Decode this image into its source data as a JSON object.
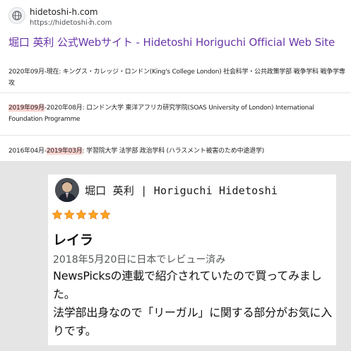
{
  "search_result": {
    "site_name": "hidetoshi-h.com",
    "site_url": "https://hidetoshi-h.com",
    "menu_icon": "more-vert-icon",
    "title": "堀口 英利 公式Webサイト - Hidetoshi Horiguchi Official Web Site",
    "title_color": "#6a36a8",
    "highlight_color": "#fad2cf",
    "entries": [
      {
        "prefix": "",
        "highlight": "",
        "rest": "2020年09月-現在: キングス・カレッジ・ロンドン(King's College London) 社会科学・公共政策学部 戦争学科 戦争学専攻"
      },
      {
        "prefix": "",
        "highlight": "2019年09月",
        "rest": "-2020年08月: ロンドン大学 東洋アフリカ研究学院(SOAS University of London) International Foundation Programme"
      },
      {
        "prefix": "2016年04月-",
        "highlight": "2019年03月",
        "rest": ": 学習院大学 法学部 政治学科 (ハラスメント被害のため中途退学)"
      }
    ]
  },
  "review": {
    "reviewer_name": "堀口 英利 | Horiguchi Hidetoshi",
    "rating": 5,
    "rating_max": 5,
    "star_color": "#ffa41c",
    "title": "レイラ",
    "date": "2018年5月20日に日本でレビュー済み",
    "body": [
      "NewsPicksの連載で紹介されていたので買ってみました。",
      "法学部出身なので「リーガル」に関する部分がお気に入りです。"
    ]
  }
}
